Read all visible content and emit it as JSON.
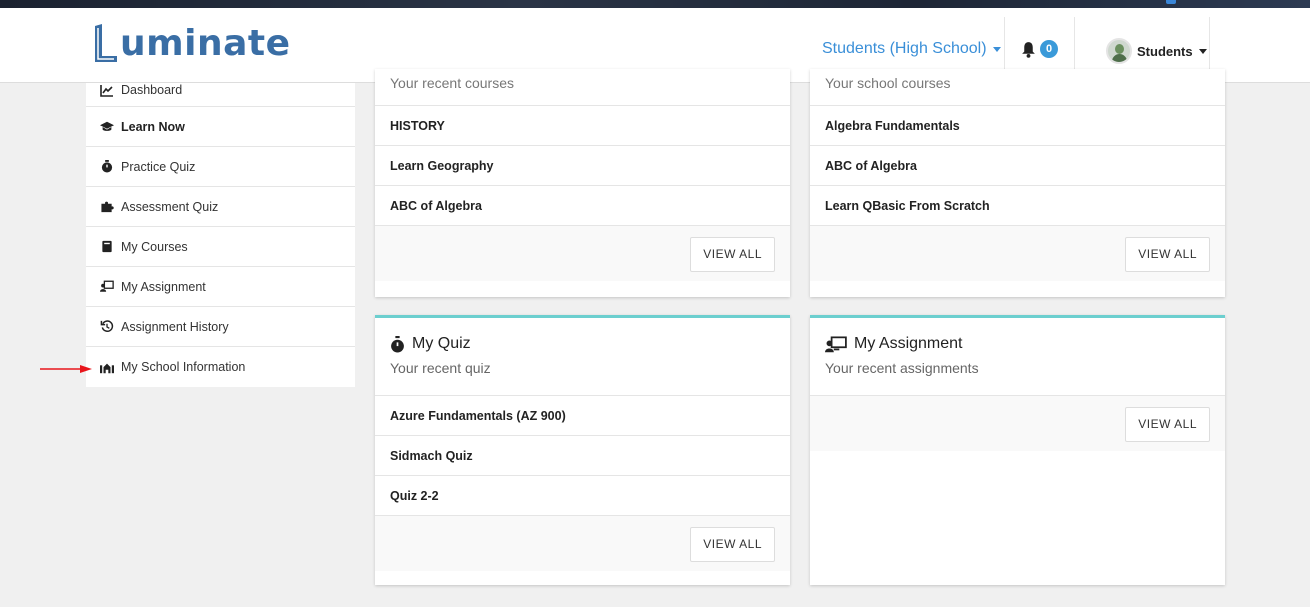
{
  "brand": {
    "name": "uminate",
    "logo_icon": "luminate-logo"
  },
  "header": {
    "role_switch": "Students (High School)",
    "notifications_count": "0",
    "user_name": "Students"
  },
  "sidebar": {
    "items": [
      {
        "label": "Dashboard",
        "icon": "chart-icon"
      },
      {
        "label": "Learn Now",
        "icon": "graduation-cap-icon"
      },
      {
        "label": "Practice Quiz",
        "icon": "stopwatch-icon"
      },
      {
        "label": "Assessment Quiz",
        "icon": "puzzle-icon"
      },
      {
        "label": "My Courses",
        "icon": "book-icon"
      },
      {
        "label": "My Assignment",
        "icon": "chalkboard-teacher-icon"
      },
      {
        "label": "Assignment History",
        "icon": "history-icon"
      },
      {
        "label": "My School Information",
        "icon": "school-icon"
      }
    ]
  },
  "cards": {
    "recent_courses": {
      "subtitle": "Your recent courses",
      "items": [
        "HISTORY",
        "Learn Geography",
        "ABC of Algebra"
      ],
      "button": "VIEW ALL"
    },
    "school_courses": {
      "subtitle": "Your school courses",
      "items": [
        "Algebra Fundamentals",
        "ABC of Algebra",
        "Learn QBasic From Scratch"
      ],
      "button": "VIEW ALL"
    },
    "my_quiz": {
      "title": "My Quiz",
      "subtitle": "Your recent quiz",
      "items": [
        "Azure Fundamentals (AZ 900)",
        "Sidmach Quiz",
        "Quiz 2-2"
      ],
      "button": "VIEW ALL"
    },
    "my_assignment": {
      "title": "My Assignment",
      "subtitle": "Your recent assignments",
      "items": [],
      "button": "VIEW ALL"
    }
  },
  "colors": {
    "accent": "#6ccfcf",
    "link": "#3a8fd8",
    "brand": "#3a6ea5",
    "arrow": "#e8151b"
  }
}
